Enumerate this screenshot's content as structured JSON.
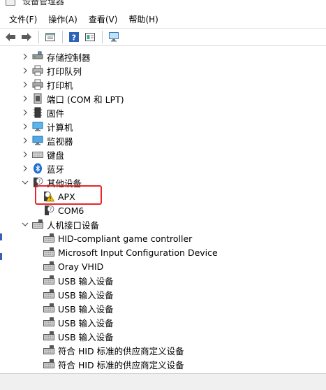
{
  "window": {
    "title": "设备管理器"
  },
  "menu": [
    "文件(F)",
    "操作(A)",
    "查看(V)",
    "帮助(H)"
  ],
  "toolbar": {
    "buttons": [
      "back-icon",
      "forward-icon",
      "properties-icon",
      "help-icon",
      "view-icon",
      "monitor-scan-icon"
    ]
  },
  "tree": {
    "categories": [
      {
        "label": "存储控制器",
        "icon": "storage-controller-icon",
        "expanded": false
      },
      {
        "label": "打印队列",
        "icon": "print-queue-icon",
        "expanded": false
      },
      {
        "label": "打印机",
        "icon": "printer-icon",
        "expanded": false
      },
      {
        "label": "端口 (COM 和 LPT)",
        "icon": "port-icon",
        "expanded": false
      },
      {
        "label": "固件",
        "icon": "firmware-icon",
        "expanded": false
      },
      {
        "label": "计算机",
        "icon": "computer-icon",
        "expanded": false
      },
      {
        "label": "监视器",
        "icon": "monitor-icon",
        "expanded": false
      },
      {
        "label": "键盘",
        "icon": "keyboard-icon",
        "expanded": false
      },
      {
        "label": "蓝牙",
        "icon": "bluetooth-icon",
        "expanded": false
      },
      {
        "label": "其他设备",
        "icon": "unknown-device-icon",
        "expanded": true
      },
      {
        "label": "人机接口设备",
        "icon": "hid-icon",
        "expanded": true
      }
    ],
    "other_devices": [
      {
        "label": "APX",
        "icon": "warning-device-icon"
      },
      {
        "label": "COM6",
        "icon": "unknown-device-icon"
      }
    ],
    "hid_devices": [
      {
        "label": "HID-compliant game controller",
        "icon": "hid-device-icon"
      },
      {
        "label": "Microsoft Input Configuration Device",
        "icon": "hid-device-icon"
      },
      {
        "label": "Oray VHID",
        "icon": "hid-device-icon"
      },
      {
        "label": "USB 输入设备",
        "icon": "hid-device-icon"
      },
      {
        "label": "USB 输入设备",
        "icon": "hid-device-icon"
      },
      {
        "label": "USB 输入设备",
        "icon": "hid-device-icon"
      },
      {
        "label": "USB 输入设备",
        "icon": "hid-device-icon"
      },
      {
        "label": "USB 输入设备",
        "icon": "hid-device-icon"
      },
      {
        "label": "符合 HID 标准的供应商定义设备",
        "icon": "hid-device-icon"
      },
      {
        "label": "符合 HID 标准的供应商定义设备",
        "icon": "hid-device-icon"
      }
    ]
  },
  "colors": {
    "highlight": "#e6262b",
    "accent": "#0078d7"
  }
}
